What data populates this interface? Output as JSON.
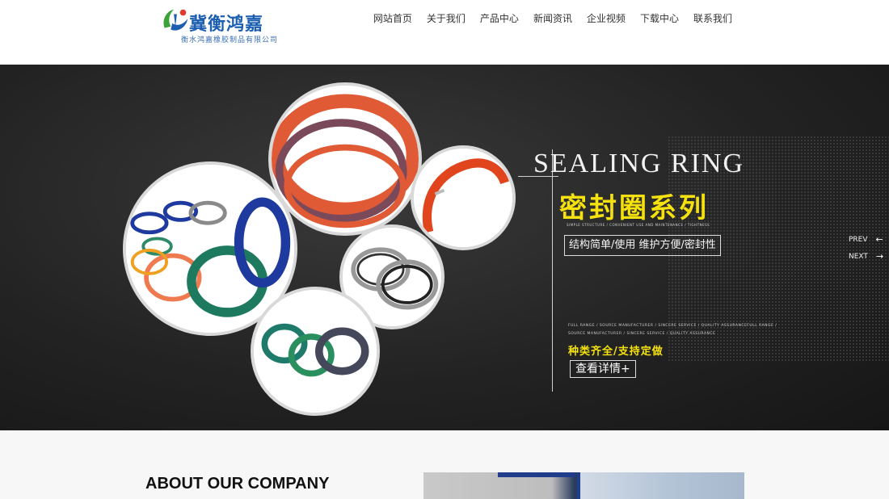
{
  "header": {
    "logo_title": "冀衡鸿嘉",
    "logo_subtitle": "衡水鸿嘉橡胶制品有限公司",
    "nav": [
      {
        "label": "网站首页"
      },
      {
        "label": "关于我们"
      },
      {
        "label": "产品中心"
      },
      {
        "label": "新闻资讯"
      },
      {
        "label": "企业视频"
      },
      {
        "label": "下载中心"
      },
      {
        "label": "联系我们"
      }
    ]
  },
  "banner": {
    "title_en": "SEALING RING",
    "title_cn": "密封圈系列",
    "tagline_small": "SIMPLE STRUCTURE / CONVENIENT USE AND MAINTENANCE / TIGHTNESS",
    "boxed_text": "结构简单/使用 维护方便/密封性",
    "small_line_1": "FULL RANGE / SOURCE MANUFACTURER / SINCERE SERVICE / QUALITY ASSURANCEFULL RANGE /",
    "small_line_2": "SOURCE MANUFACTURER / SINCERE SERVICE / QUALITY ASSURANCE",
    "yellow_text": "种类齐全/支持定做",
    "detail_button": "查看详情+",
    "prev_label": "PREV",
    "next_label": "NEXT"
  },
  "about": {
    "title": "ABOUT OUR COMPANY"
  },
  "colors": {
    "accent_yellow": "#f5e10e",
    "logo_blue": "#1c5fb0",
    "logo_green": "#3aa33a"
  }
}
